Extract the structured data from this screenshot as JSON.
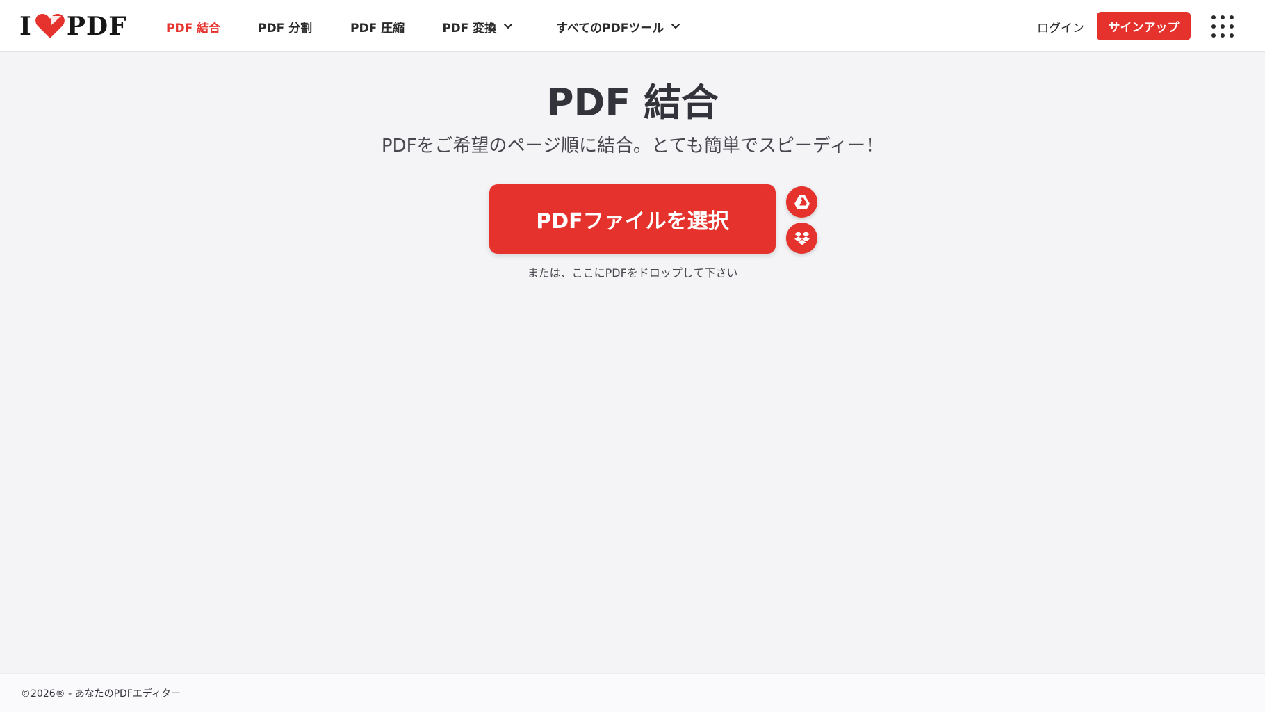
{
  "brand": {
    "logo_prefix": "I",
    "logo_suffix": "PDF",
    "accent_color": "#e5322d"
  },
  "nav": {
    "items": [
      {
        "label": "PDF 結合",
        "active": true
      },
      {
        "label": "PDF 分割"
      },
      {
        "label": "PDF 圧縮"
      },
      {
        "label": "PDF 変換",
        "dropdown": true
      },
      {
        "label": "すべてのPDFツール",
        "dropdown": true
      }
    ],
    "login_label": "ログイン",
    "signup_label": "サインアップ",
    "apps_icon": "grid-icon"
  },
  "main": {
    "title": "PDF 結合",
    "subtitle": "PDFをご希望のページ順に結合。とても簡単でスピーディー！",
    "select_button_label": "PDFファイルを選択",
    "cloud_buttons": [
      {
        "icon": "google-drive-icon"
      },
      {
        "icon": "dropbox-icon"
      }
    ],
    "drop_hint": "または、ここにPDFをドロップして下さい"
  },
  "footer": {
    "copyright": "©2026® - あなたのPDFエディター"
  }
}
